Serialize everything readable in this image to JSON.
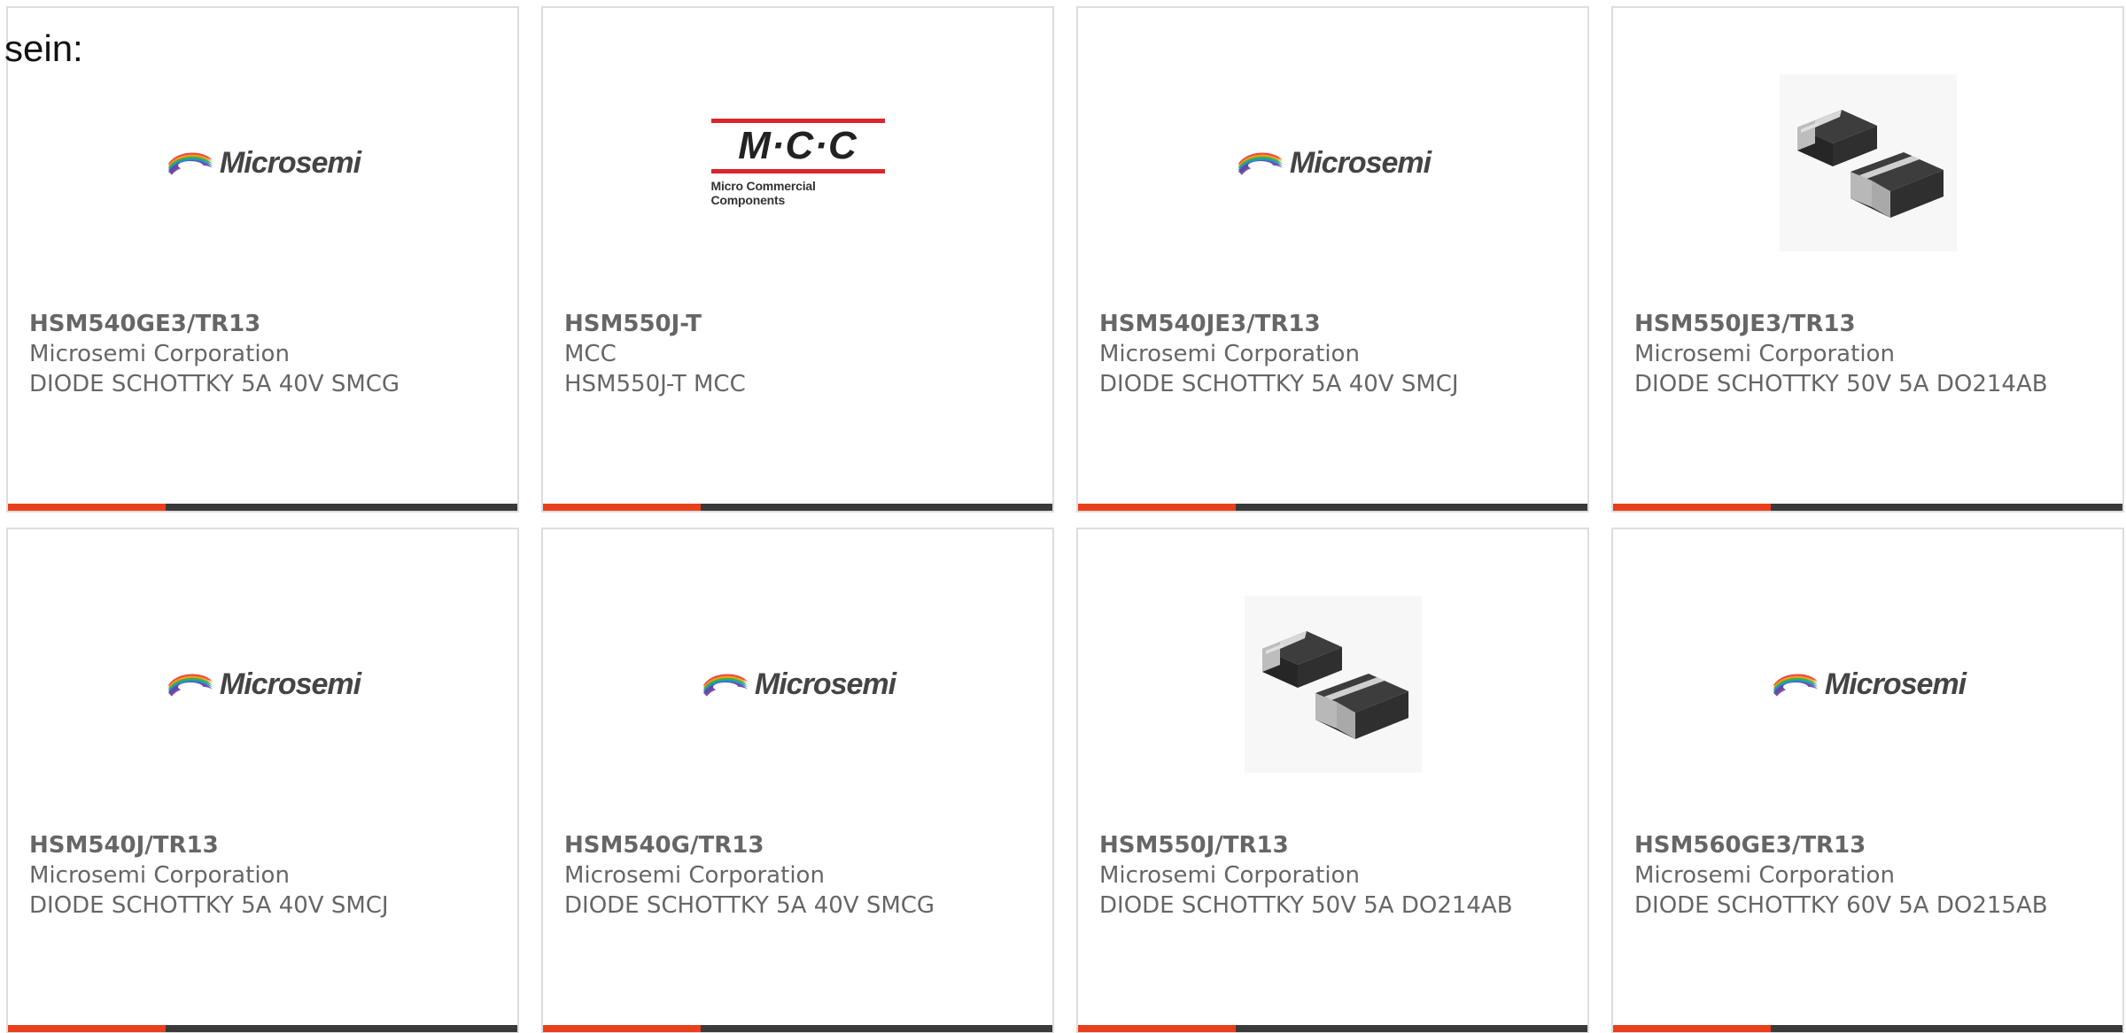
{
  "intro_text": "sein:",
  "colors": {
    "accent": "#e8401c",
    "bar": "#3a3a3a",
    "text": "#666666",
    "border": "#dddddd",
    "mcc_red": "#d9262c"
  },
  "products": [
    {
      "part_number": "HSM540GE3/TR13",
      "manufacturer": "Microsemi Corporation",
      "description": "DIODE SCHOTTKY 5A 40V SMCG",
      "image": "microsemi-logo",
      "logo_text": "Microsemi",
      "progress": 0.31
    },
    {
      "part_number": "HSM550J-T",
      "manufacturer": "MCC",
      "description": "HSM550J-T MCC",
      "image": "mcc-logo",
      "logo_text": "M·C·C",
      "logo_subtext": "Micro Commercial Components",
      "progress": 0.31
    },
    {
      "part_number": "HSM540JE3/TR13",
      "manufacturer": "Microsemi Corporation",
      "description": "DIODE SCHOTTKY 5A 40V SMCJ",
      "image": "microsemi-logo",
      "logo_text": "Microsemi",
      "progress": 0.31
    },
    {
      "part_number": "HSM550JE3/TR13",
      "manufacturer": "Microsemi Corporation",
      "description": "DIODE SCHOTTKY 50V 5A DO214AB",
      "image": "smd-diode-photo",
      "progress": 0.31
    },
    {
      "part_number": "HSM540J/TR13",
      "manufacturer": "Microsemi Corporation",
      "description": "DIODE SCHOTTKY 5A 40V SMCJ",
      "image": "microsemi-logo",
      "logo_text": "Microsemi",
      "progress": 0.31
    },
    {
      "part_number": "HSM540G/TR13",
      "manufacturer": "Microsemi Corporation",
      "description": "DIODE SCHOTTKY 5A 40V SMCG",
      "image": "microsemi-logo",
      "logo_text": "Microsemi",
      "progress": 0.31
    },
    {
      "part_number": "HSM550J/TR13",
      "manufacturer": "Microsemi Corporation",
      "description": "DIODE SCHOTTKY 50V 5A DO214AB",
      "image": "smd-diode-photo",
      "progress": 0.31
    },
    {
      "part_number": "HSM560GE3/TR13",
      "manufacturer": "Microsemi Corporation",
      "description": "DIODE SCHOTTKY 60V 5A DO215AB",
      "image": "microsemi-logo",
      "logo_text": "Microsemi",
      "progress": 0.31
    }
  ]
}
